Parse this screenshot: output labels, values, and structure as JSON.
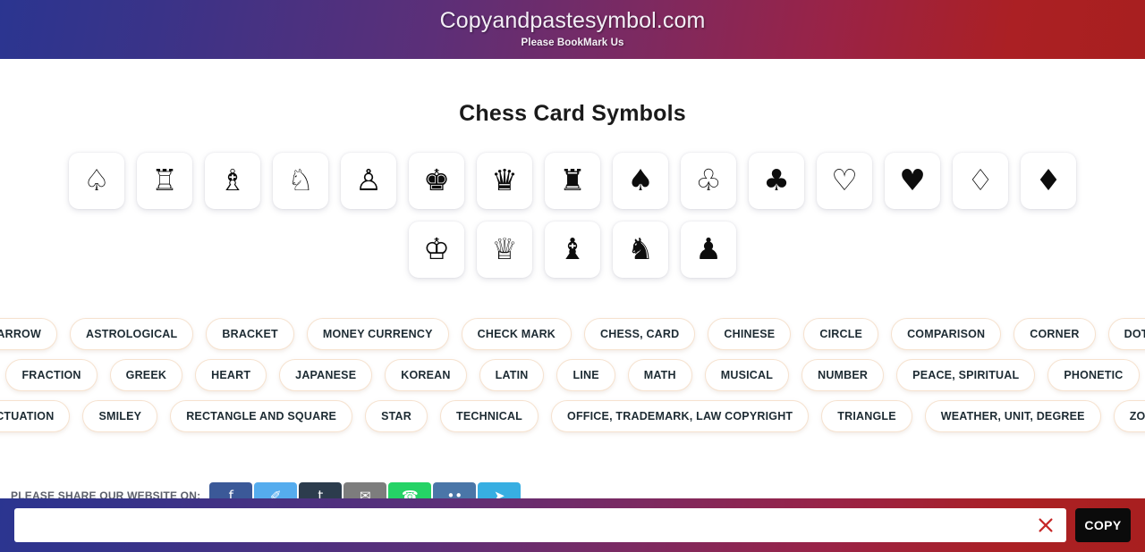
{
  "header": {
    "title": "Copyandpastesymbol.com",
    "subtitle": "Please BookMark Us",
    "gradient_from": "#2b3590",
    "gradient_to": "#a81f1f"
  },
  "main": {
    "page_title": "Chess Card Symbols"
  },
  "symbols": {
    "row1": [
      {
        "glyph": "♤",
        "name": "white-spade-suit"
      },
      {
        "glyph": "♖",
        "name": "white-chess-rook"
      },
      {
        "glyph": "♗",
        "name": "white-chess-bishop"
      },
      {
        "glyph": "♘",
        "name": "white-chess-knight"
      },
      {
        "glyph": "♙",
        "name": "white-chess-pawn"
      },
      {
        "glyph": "♚",
        "name": "black-chess-king"
      },
      {
        "glyph": "♛",
        "name": "black-chess-queen"
      },
      {
        "glyph": "♜",
        "name": "black-chess-rook"
      },
      {
        "glyph": "♠",
        "name": "black-spade-suit"
      },
      {
        "glyph": "♧",
        "name": "white-club-suit"
      },
      {
        "glyph": "♣",
        "name": "black-club-suit"
      },
      {
        "glyph": "♡",
        "name": "white-heart-suit"
      },
      {
        "glyph": "♥",
        "name": "black-heart-suit"
      },
      {
        "glyph": "♢",
        "name": "white-diamond-suit"
      },
      {
        "glyph": "♦",
        "name": "black-diamond-suit"
      }
    ],
    "row2": [
      {
        "glyph": "♔",
        "name": "white-chess-king"
      },
      {
        "glyph": "♕",
        "name": "white-chess-queen"
      },
      {
        "glyph": "♝",
        "name": "black-chess-bishop"
      },
      {
        "glyph": "♞",
        "name": "black-chess-knight"
      },
      {
        "glyph": "♟",
        "name": "black-chess-pawn"
      }
    ]
  },
  "categories": {
    "row1": [
      "ARROW",
      "ASTROLOGICAL",
      "BRACKET",
      "MONEY CURRENCY",
      "CHECK MARK",
      "CHESS, CARD",
      "CHINESE",
      "CIRCLE",
      "COMPARISON",
      "CORNER",
      "DOT"
    ],
    "row2": [
      "FRACTION",
      "GREEK",
      "HEART",
      "JAPANESE",
      "KOREAN",
      "LATIN",
      "LINE",
      "MATH",
      "MUSICAL",
      "NUMBER",
      "PEACE, SPIRITUAL",
      "PHONETIC"
    ],
    "row3": [
      "PUNCTUATION",
      "SMILEY",
      "RECTANGLE AND SQUARE",
      "STAR",
      "TECHNICAL",
      "OFFICE, TRADEMARK, LAW COPYRIGHT",
      "TRIANGLE",
      "WEATHER, UNIT, DEGREE",
      "ZODIAC"
    ]
  },
  "share": {
    "label": "PLEASE SHARE OUR WEBSITE ON:",
    "buttons": [
      {
        "name": "facebook-share-button",
        "glyph": "f",
        "color": "#3b5998"
      },
      {
        "name": "twitter-share-button",
        "glyph": "✐",
        "color": "#55acee"
      },
      {
        "name": "tumblr-share-button",
        "glyph": "t",
        "color": "#2c3c4d"
      },
      {
        "name": "email-share-button",
        "glyph": "✉",
        "color": "#7d7d7d"
      },
      {
        "name": "whatsapp-share-button",
        "glyph": "☎",
        "color": "#25d366"
      },
      {
        "name": "vk-share-button",
        "glyph": "••",
        "color": "#4a76a8"
      },
      {
        "name": "telegram-share-button",
        "glyph": "➤",
        "color": "#37aee2"
      }
    ]
  },
  "copy_bar": {
    "input_value": "",
    "input_placeholder": "",
    "clear_label": "×",
    "clear_color": "#c62828",
    "copy_label": "COPY"
  }
}
